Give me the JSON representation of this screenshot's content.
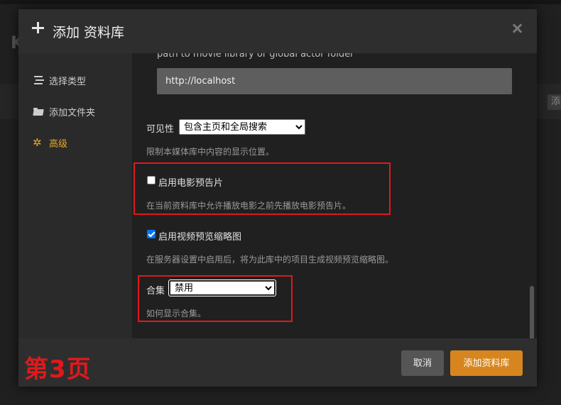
{
  "background": {
    "letter": "K",
    "tag": "添"
  },
  "modal": {
    "title": "添加 资料库"
  },
  "sidebar": {
    "items": [
      {
        "label": "选择类型",
        "icon": "list-icon"
      },
      {
        "label": "添加文件夹",
        "icon": "folder-icon"
      },
      {
        "label": "高级",
        "icon": "gear-icon",
        "active": true
      }
    ]
  },
  "content": {
    "cut_text": "path to movie library or global actor folder",
    "url_value": "http://localhost",
    "visibility": {
      "label": "可见性",
      "selected": "包含主页和全局搜索",
      "help": "限制本媒体库中内容的显示位置。"
    },
    "trailers": {
      "label": "启用电影预告片",
      "checked": false,
      "help": "在当前资料库中允许播放电影之前先播放电影预告片。"
    },
    "thumbnails": {
      "label": "启用视频预览缩略图",
      "checked": true,
      "help": "在服务器设置中启用后，将为此库中的项目生成视频预览缩略图。"
    },
    "collections": {
      "label": "合集",
      "selected": "禁用",
      "help": "如何显示合集。"
    }
  },
  "footer": {
    "page_label": "第3页",
    "cancel": "取消",
    "add": "添加资料库"
  },
  "colors": {
    "accent": "#d7861f",
    "active": "#e9a62b",
    "annotation": "#e0191c"
  }
}
